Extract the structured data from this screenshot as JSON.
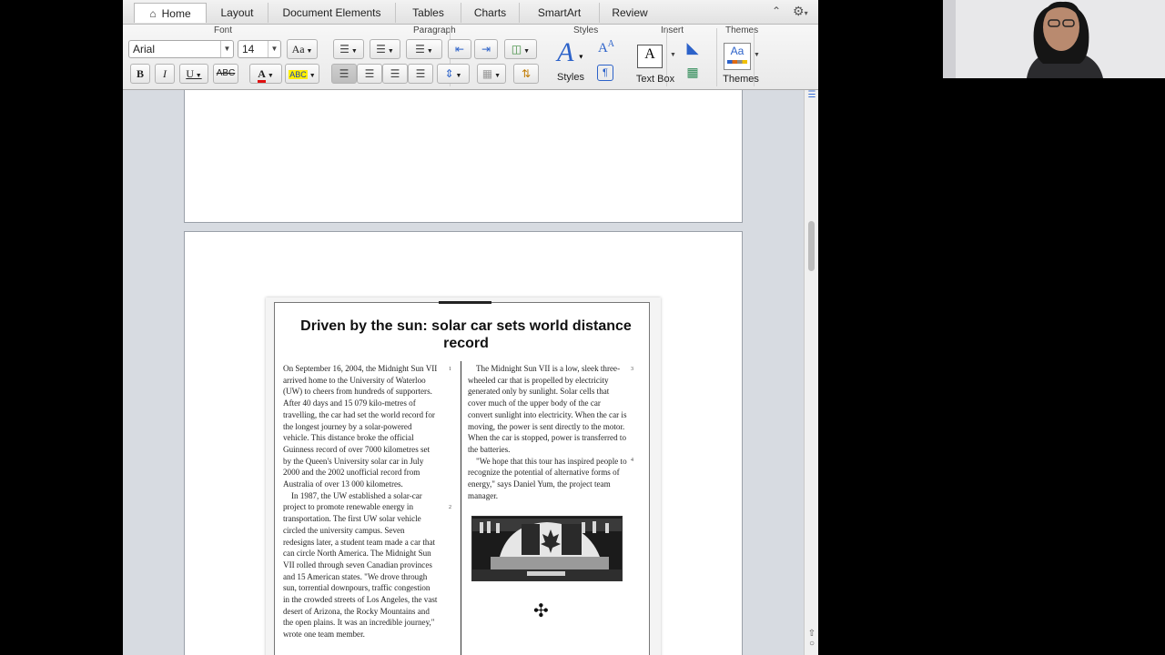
{
  "ribbon_tabs": {
    "home": "Home",
    "layout": "Layout",
    "document_elements": "Document Elements",
    "tables": "Tables",
    "charts": "Charts",
    "smartart": "SmartArt",
    "review": "Review"
  },
  "groups": {
    "font": "Font",
    "paragraph": "Paragraph",
    "styles": "Styles",
    "insert": "Insert",
    "themes": "Themes"
  },
  "font": {
    "name": "Arial",
    "size": "14",
    "bold": "B",
    "italic": "I",
    "underline": "U",
    "strike": "ABC",
    "grow_shrink": "Aa",
    "highlight": "ABC"
  },
  "big_buttons": {
    "styles": "Styles",
    "text_box": "Text Box",
    "themes": "Themes"
  },
  "article": {
    "title": "Driven by the sun: solar car sets world distance record",
    "left_column": [
      "On September 16, 2004, the Midnight Sun VII arrived home to the University of Waterloo (UW) to cheers from hundreds of supporters. After 40 days and 15 079 kilo-metres of travelling, the car had set the world record for the longest journey by a solar-powered vehicle. This distance broke the official Guinness record of over 7000 kilometres set by the Queen's University solar car in July 2000 and the 2002 unofficial record from Australia of over 13 000 kilometres.",
      "In 1987, the UW established a solar-car project to promote renewable energy in transportation. The first UW solar vehicle circled the university campus. Seven redesigns later, a student team made a car that can circle North America. The Midnight Sun VII rolled through seven Canadian provinces and 15 American states. \"We drove through sun, torrential downpours, traffic congestion in the crowded streets of Los Angeles, the vast desert of Arizona, the Rocky Mountains and the open plains. It was an incredible journey,\" wrote one team member."
    ],
    "right_column": [
      "The Midnight Sun VII is a low, sleek three-wheeled car that is propelled by electricity generated only by sunlight. Solar cells that cover much of the upper body of the car convert sunlight into electricity. When the car is moving, the power is sent directly to the motor. When the car is stopped, power is transferred to the batteries.",
      "\"We hope that this tour has inspired people to recognize the potential of alternative forms of energy,\" says Daniel Yum, the project team manager."
    ],
    "line_numbers": [
      "1",
      "2",
      "3",
      "4"
    ]
  },
  "icons": {
    "home": "home-icon",
    "gear": "gear-icon",
    "collapse": "chevron-up-icon",
    "cursor": "move-cursor-icon"
  }
}
